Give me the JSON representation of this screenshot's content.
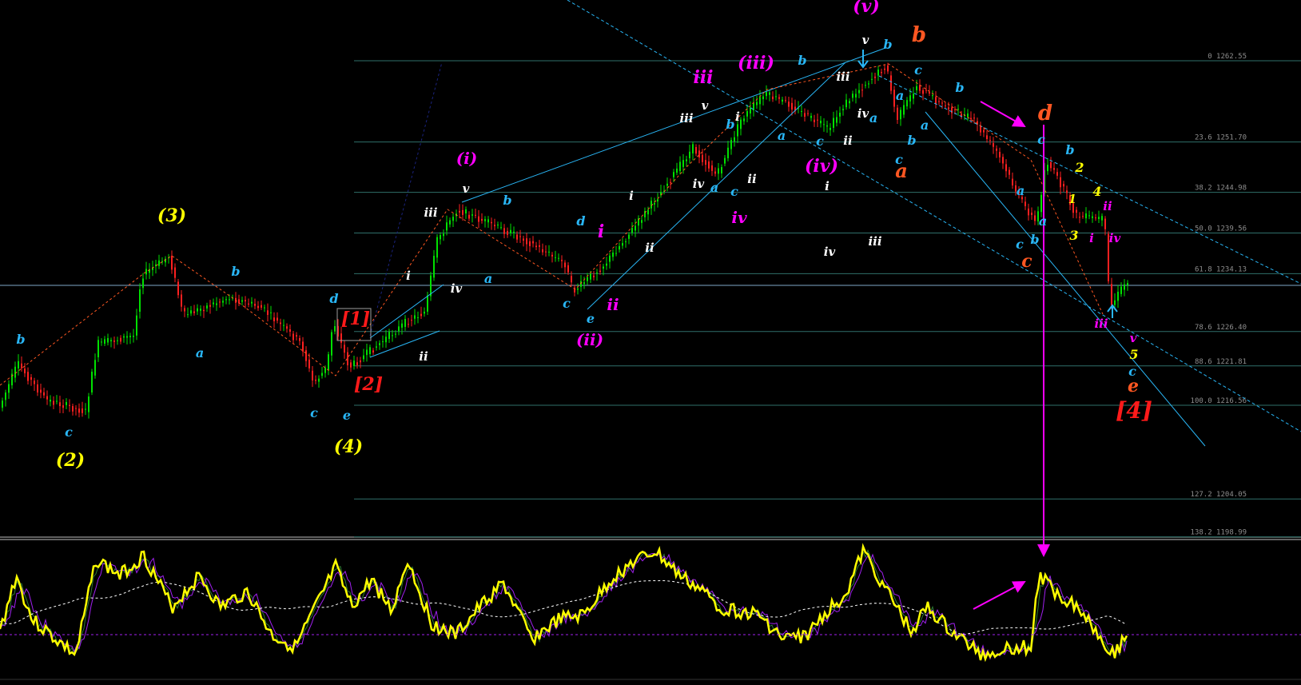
{
  "chart_data": {
    "type": "candlestick",
    "panes": [
      "price",
      "oscillator"
    ],
    "fib_levels": [
      {
        "ratio": "0",
        "price": 1262.55,
        "label": "0 1262.55"
      },
      {
        "ratio": "23.6",
        "price": 1251.7,
        "label": "23.6 1251.70"
      },
      {
        "ratio": "38.2",
        "price": 1244.98,
        "label": "38.2 1244.98"
      },
      {
        "ratio": "50.0",
        "price": 1239.56,
        "label": "50.0 1239.56"
      },
      {
        "ratio": "61.8",
        "price": 1234.13,
        "label": "61.8 1234.13"
      },
      {
        "ratio": "78.6",
        "price": 1226.4,
        "label": "78.6 1226.40"
      },
      {
        "ratio": "88.6",
        "price": 1221.81,
        "label": "88.6 1221.81"
      },
      {
        "ratio": "100.0",
        "price": 1216.56,
        "label": "100.0 1216.56"
      },
      {
        "ratio": "127.2",
        "price": 1204.05,
        "label": "127.2 1204.05"
      },
      {
        "ratio": "138.2",
        "price": 1198.99,
        "label": "138.2 1198.99"
      }
    ],
    "wave_labels": [
      {
        "text": "(2)",
        "color": "#ffff00"
      },
      {
        "text": "(3)",
        "color": "#ffff00"
      },
      {
        "text": "(4)",
        "color": "#ffff00"
      },
      {
        "text": "c",
        "color": "#29b6f6"
      },
      {
        "text": "b",
        "color": "#29b6f6"
      },
      {
        "text": "a",
        "color": "#29b6f6"
      },
      {
        "text": "b",
        "color": "#29b6f6"
      },
      {
        "text": "d",
        "color": "#29b6f6"
      },
      {
        "text": "c",
        "color": "#29b6f6"
      },
      {
        "text": "e",
        "color": "#29b6f6"
      },
      {
        "text": "[1]",
        "color": "#ff1a1a"
      },
      {
        "text": "[2]",
        "color": "#ff1a1a"
      },
      {
        "text": "i",
        "color": "#ffffff"
      },
      {
        "text": "ii",
        "color": "#ffffff"
      },
      {
        "text": "iii",
        "color": "#ffffff"
      },
      {
        "text": "iv",
        "color": "#ffffff"
      },
      {
        "text": "v",
        "color": "#ffffff"
      },
      {
        "text": "(i)",
        "color": "#ff00ff"
      },
      {
        "text": "b",
        "color": "#29b6f6"
      },
      {
        "text": "a",
        "color": "#29b6f6"
      },
      {
        "text": "c",
        "color": "#29b6f6"
      },
      {
        "text": "d",
        "color": "#29b6f6"
      },
      {
        "text": "e",
        "color": "#29b6f6"
      },
      {
        "text": "(ii)",
        "color": "#ff00ff"
      },
      {
        "text": "i",
        "color": "#ff00ff"
      },
      {
        "text": "ii",
        "color": "#ff00ff"
      },
      {
        "text": "ii",
        "color": "#ffffff"
      },
      {
        "text": "i",
        "color": "#ffffff"
      },
      {
        "text": "iii",
        "color": "#ff00ff"
      },
      {
        "text": "iii",
        "color": "#ffffff"
      },
      {
        "text": "v",
        "color": "#ffffff"
      },
      {
        "text": "iv",
        "color": "#ffffff"
      },
      {
        "text": "a",
        "color": "#29b6f6"
      },
      {
        "text": "c",
        "color": "#29b6f6"
      },
      {
        "text": "ii",
        "color": "#ffffff"
      },
      {
        "text": "b",
        "color": "#29b6f6"
      },
      {
        "text": "i",
        "color": "#ffffff"
      },
      {
        "text": "iv",
        "color": "#ff00ff"
      },
      {
        "text": "(iii)",
        "color": "#ff00ff"
      },
      {
        "text": "b",
        "color": "#29b6f6"
      },
      {
        "text": "a",
        "color": "#29b6f6"
      },
      {
        "text": "c",
        "color": "#29b6f6"
      },
      {
        "text": "(iv)",
        "color": "#ff00ff"
      },
      {
        "text": "i",
        "color": "#ffffff"
      },
      {
        "text": "ii",
        "color": "#ffffff"
      },
      {
        "text": "iii",
        "color": "#ffffff"
      },
      {
        "text": "iv",
        "color": "#ffffff"
      },
      {
        "text": "a",
        "color": "#29b6f6"
      },
      {
        "text": "v",
        "color": "#ffffff"
      },
      {
        "text": "(v)",
        "color": "#ff00ff"
      },
      {
        "text": "b",
        "color": "#29b6f6"
      },
      {
        "text": "iii",
        "color": "#ffffff"
      },
      {
        "text": "iv",
        "color": "#ffffff"
      },
      {
        "text": "b",
        "color": "#ff5722"
      },
      {
        "text": "c",
        "color": "#29b6f6"
      },
      {
        "text": "a",
        "color": "#29b6f6"
      },
      {
        "text": "a",
        "color": "#29b6f6"
      },
      {
        "text": "c",
        "color": "#29b6f6"
      },
      {
        "text": "b",
        "color": "#29b6f6"
      },
      {
        "text": "a",
        "color": "#ff5722"
      },
      {
        "text": "b",
        "color": "#29b6f6"
      },
      {
        "text": "d",
        "color": "#ff5722"
      },
      {
        "text": "c",
        "color": "#29b6f6"
      },
      {
        "text": "b",
        "color": "#29b6f6"
      },
      {
        "text": "2",
        "color": "#ffff00"
      },
      {
        "text": "a",
        "color": "#29b6f6"
      },
      {
        "text": "4",
        "color": "#ffff00"
      },
      {
        "text": "1",
        "color": "#ffff00"
      },
      {
        "text": "ii",
        "color": "#ff00ff"
      },
      {
        "text": "a",
        "color": "#29b6f6"
      },
      {
        "text": "c",
        "color": "#29b6f6"
      },
      {
        "text": "b",
        "color": "#29b6f6"
      },
      {
        "text": "3",
        "color": "#ffff00"
      },
      {
        "text": "i",
        "color": "#ff00ff"
      },
      {
        "text": "iv",
        "color": "#ff00ff"
      },
      {
        "text": "c",
        "color": "#ff5722"
      },
      {
        "text": "iii",
        "color": "#ff00ff"
      },
      {
        "text": "v",
        "color": "#ff00ff"
      },
      {
        "text": "5",
        "color": "#ffff00"
      },
      {
        "text": "c",
        "color": "#29b6f6"
      },
      {
        "text": "e",
        "color": "#ff5722"
      },
      {
        "text": "[4]",
        "color": "#ff1a1a"
      }
    ],
    "colors": {
      "bull": "#00e000",
      "bear": "#ff2020",
      "oscillator": "#ffff00",
      "oscillator_signal_1": "#2e7d32",
      "oscillator_signal_2": "#a020f0",
      "oscillator_ma": "#ffffff",
      "channel": "#29b6f6",
      "arrow": "#ff00ff",
      "fib_line": "#2f6f6a",
      "current_price_line": "#7fa7c9"
    }
  }
}
